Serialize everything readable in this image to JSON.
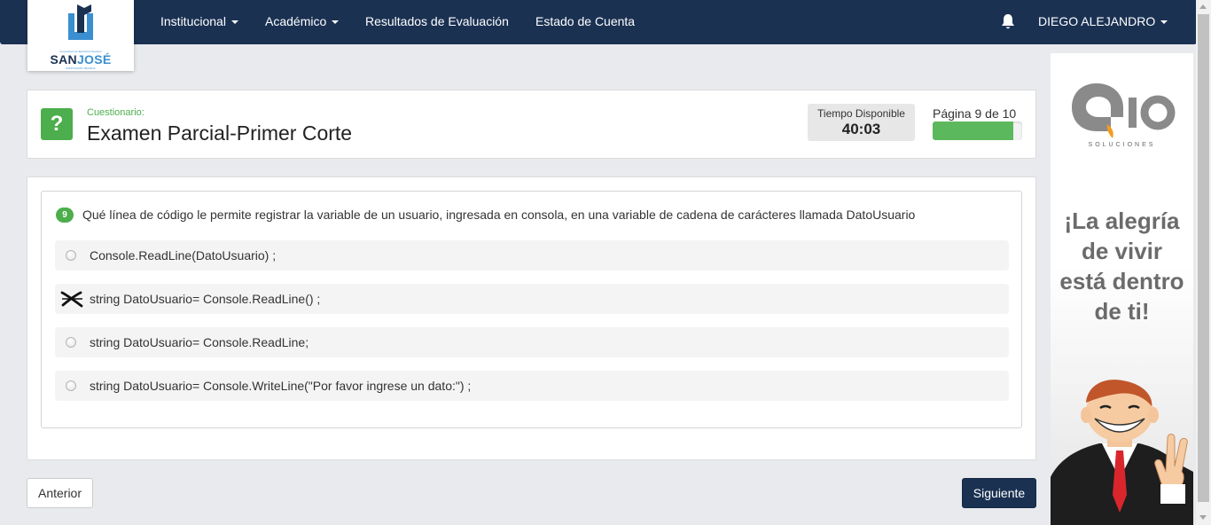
{
  "logo": {
    "tagline": "Corporación de Educación Superior",
    "brand_part1": "SAN",
    "brand_part2": "JOSÉ",
    "subtag": "INSTITUCIÓN TÉCNICA"
  },
  "nav": {
    "items": [
      {
        "label": "Institucional",
        "has_dropdown": true
      },
      {
        "label": "Académico",
        "has_dropdown": true
      },
      {
        "label": "Resultados de Evaluación",
        "has_dropdown": false
      },
      {
        "label": "Estado de Cuenta",
        "has_dropdown": false
      }
    ],
    "user_name": "DIEGO ALEJANDRO",
    "bell_icon": "bell-icon"
  },
  "exam": {
    "section_label": "Cuestionario:",
    "title": "Examen Parcial-Primer Corte",
    "timer_label": "Tiempo Disponible",
    "timer_value": "40:03",
    "page_label": "Página 9 de 10",
    "progress_fraction": 0.9
  },
  "question": {
    "number": "9",
    "text": "Qué línea de código le permite registrar la variable de un usuario, ingresada en consola, en una variable de cadena de carácteres llamada DatoUsuario",
    "options": [
      {
        "text": "Console.ReadLine(DatoUsuario) ;",
        "marked": false
      },
      {
        "text": "string DatoUsuario= Console.ReadLine() ;",
        "marked": true
      },
      {
        "text": "string DatoUsuario= Console.ReadLine;",
        "marked": false
      },
      {
        "text": "string DatoUsuario= Console.WriteLine(\"Por favor ingrese un dato:\") ;",
        "marked": false
      }
    ]
  },
  "buttons": {
    "prev": "Anterior",
    "next": "Siguiente"
  },
  "ad": {
    "brand_sub": "SOLUCIONES",
    "slogan_lines": [
      "¡La alegría",
      "de vivir",
      "está dentro",
      "de ti!"
    ]
  },
  "colors": {
    "navbar": "#1a3152",
    "accent_green": "#4cae4c",
    "progress": "#5cb85c",
    "brand_blue": "#3a8fd1"
  }
}
